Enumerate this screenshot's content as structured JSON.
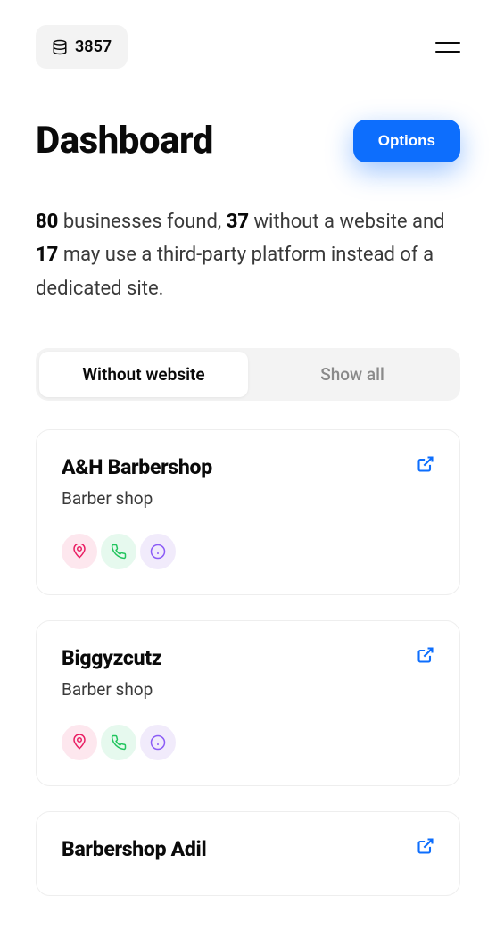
{
  "header": {
    "credits": "3857"
  },
  "page": {
    "title": "Dashboard",
    "options_label": "Options"
  },
  "summary": {
    "total": "80",
    "text1": " businesses found, ",
    "without": "37",
    "text2": " without a website and ",
    "thirdparty": "17",
    "text3": " may use a third-party platform instead of a dedicated site."
  },
  "tabs": {
    "without": "Without website",
    "all": "Show all"
  },
  "businesses": [
    {
      "name": "A&H Barbershop",
      "category": "Barber shop"
    },
    {
      "name": "Biggyzcutz",
      "category": "Barber shop"
    },
    {
      "name": "Barbershop Adil",
      "category": ""
    }
  ]
}
